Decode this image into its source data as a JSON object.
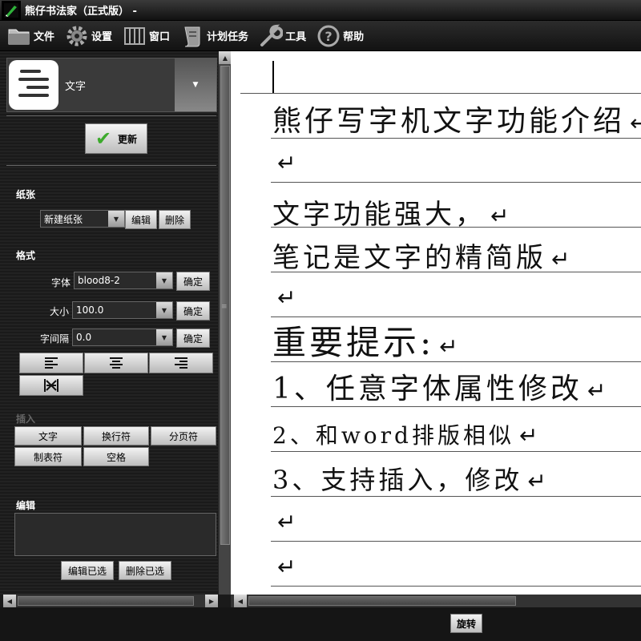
{
  "window": {
    "title": "熊仔书法家（正式版） -"
  },
  "menu": [
    {
      "label": "文件",
      "icon": "folder-icon"
    },
    {
      "label": "设置",
      "icon": "gear-icon"
    },
    {
      "label": "窗口",
      "icon": "window-icon"
    },
    {
      "label": "计划任务",
      "icon": "scroll-icon"
    },
    {
      "label": "工具",
      "icon": "wrench-icon"
    },
    {
      "label": "帮助",
      "icon": "help-icon"
    }
  ],
  "left": {
    "mode_label": "文字",
    "update_label": "更新",
    "paper": {
      "section": "纸张",
      "selected": "新建纸张",
      "edit": "编辑",
      "delete": "删除"
    },
    "format": {
      "section": "格式",
      "font_label": "字体",
      "font_value": "blood8-2",
      "size_label": "大小",
      "size_value": "100.0",
      "spacing_label": "字间隔",
      "spacing_value": "0.0",
      "confirm": "确定"
    },
    "insert": {
      "section": "插入",
      "text": "文字",
      "line_break": "换行符",
      "page_break": "分页符",
      "tab": "制表符",
      "space": "空格"
    },
    "edit": {
      "section": "编辑",
      "edit_selected": "编辑已选",
      "delete_selected": "删除已选"
    }
  },
  "document": {
    "lines": [
      "熊仔写字机文字功能介绍",
      "",
      "文字功能强大，",
      "笔记是文字的精简版",
      "",
      "重要提示:",
      "1、任意字体属性修改",
      "2、和word排版相似",
      "3、支持插入，修改",
      "",
      ""
    ],
    "return_symbol": "↵"
  },
  "bottom": {
    "rotate": "旋转"
  }
}
